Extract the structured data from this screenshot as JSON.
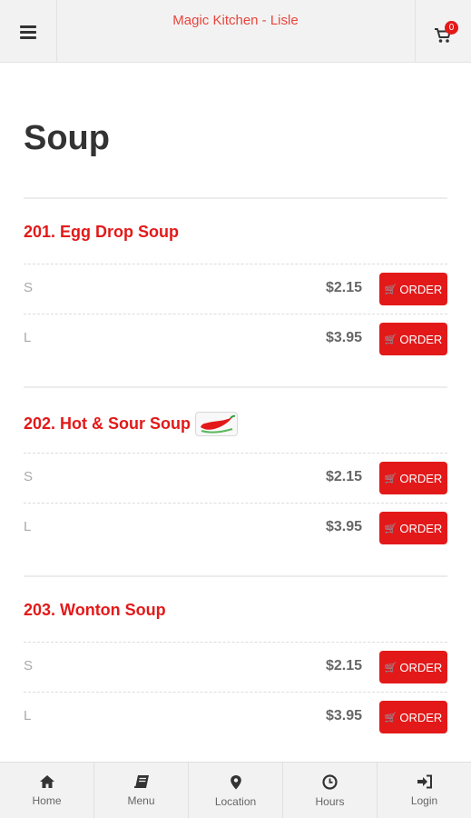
{
  "header": {
    "title": "Magic Kitchen - Lisle",
    "cart_count": "0",
    "menu_icon": "hamburger-icon",
    "cart_icon": "cart-icon"
  },
  "page": {
    "title": "Soup"
  },
  "items": [
    {
      "name": "201. Egg Drop Soup",
      "spicy": false,
      "options": [
        {
          "size": "S",
          "price": "$2.15",
          "button": "ORDER"
        },
        {
          "size": "L",
          "price": "$3.95",
          "button": "ORDER"
        }
      ]
    },
    {
      "name": "202. Hot & Sour Soup",
      "spicy": true,
      "options": [
        {
          "size": "S",
          "price": "$2.15",
          "button": "ORDER"
        },
        {
          "size": "L",
          "price": "$3.95",
          "button": "ORDER"
        }
      ]
    },
    {
      "name": "203. Wonton Soup",
      "spicy": false,
      "options": [
        {
          "size": "S",
          "price": "$2.15",
          "button": "ORDER"
        },
        {
          "size": "L",
          "price": "$3.95",
          "button": "ORDER"
        }
      ]
    }
  ],
  "tabbar": [
    {
      "label": "Home",
      "icon": "home-icon"
    },
    {
      "label": "Menu",
      "icon": "book-icon"
    },
    {
      "label": "Location",
      "icon": "map-marker-icon"
    },
    {
      "label": "Hours",
      "icon": "clock-icon"
    },
    {
      "label": "Login",
      "icon": "sign-in-icon"
    }
  ],
  "colors": {
    "accent": "#e31919",
    "header_bg": "#f2f2f2",
    "title_text": "#333333"
  }
}
